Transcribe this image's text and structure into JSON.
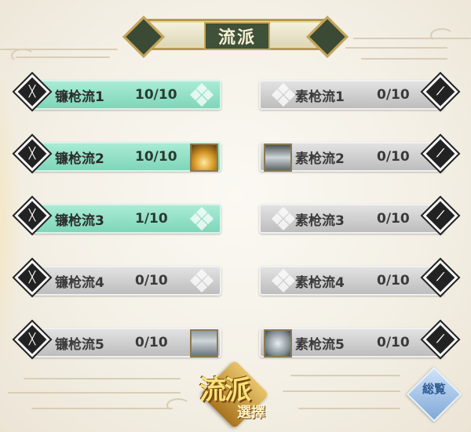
{
  "title": "流派",
  "left_column": [
    {
      "name": "镰枪流1",
      "count": "10/10",
      "state": "active",
      "slot": "diamonds"
    },
    {
      "name": "镰枪流2",
      "count": "10/10",
      "state": "active",
      "slot": "fire-skill-icon"
    },
    {
      "name": "镰枪流3",
      "count": "1/10",
      "state": "active",
      "slot": "diamonds"
    },
    {
      "name": "镰枪流4",
      "count": "0/10",
      "state": "inactive",
      "slot": "diamonds"
    },
    {
      "name": "镰枪流5",
      "count": "0/10",
      "state": "inactive",
      "slot": "storm-skill-icon"
    }
  ],
  "right_column": [
    {
      "name": "素枪流1",
      "count": "0/10",
      "state": "inactive",
      "slot": "diamonds"
    },
    {
      "name": "素枪流2",
      "count": "0/10",
      "state": "inactive",
      "slot": "wave-skill-icon"
    },
    {
      "name": "素枪流3",
      "count": "0/10",
      "state": "inactive",
      "slot": "diamonds"
    },
    {
      "name": "素枪流4",
      "count": "0/10",
      "state": "inactive",
      "slot": "diamonds"
    },
    {
      "name": "素枪流5",
      "count": "0/10",
      "state": "inactive",
      "slot": "tornado-skill-icon"
    }
  ],
  "select_button": {
    "line1": "流派",
    "line2": "選擇"
  },
  "overview_button": {
    "label": "総覧"
  },
  "colors": {
    "active_bar": "#8fdcc2",
    "inactive_bar": "#cfcfcf",
    "title_plate": "#3f5138",
    "gold": "#c6a558"
  }
}
